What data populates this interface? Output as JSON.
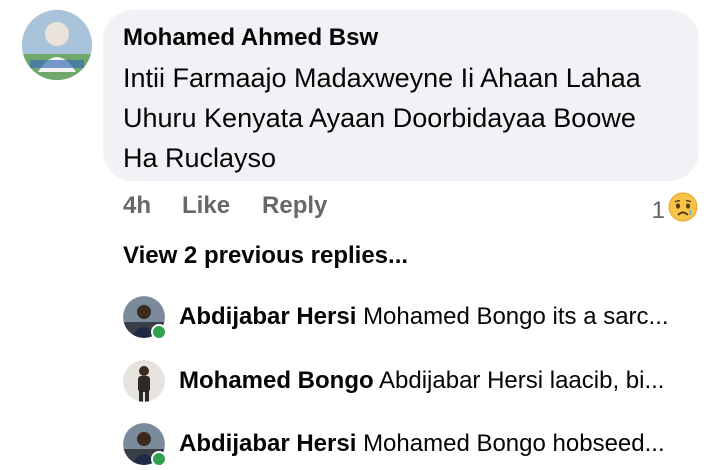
{
  "comment": {
    "author": "Mohamed Ahmed Bsw",
    "text": "Intii Farmaajo Madaxweyne Ii Ahaan Lahaa Uhuru Kenyata  Ayaan Doorbidayaa Boowe Ha Ruclayso",
    "time": "4h",
    "like_label": "Like",
    "reply_label": "Reply",
    "reaction_count": "1",
    "reaction_icon": "sad-face-icon"
  },
  "view_previous": "View 2 previous replies...",
  "replies": [
    {
      "name": "Abdijabar Hersi",
      "snippet": "Mohamed Bongo its a sarc...",
      "online": true
    },
    {
      "name": "Mohamed Bongo",
      "snippet": "Abdijabar Hersi laacib, bi...",
      "online": false
    },
    {
      "name": "Abdijabar Hersi",
      "snippet": "Mohamed Bongo hobseed...",
      "online": true
    }
  ],
  "colors": {
    "bubble": "#f0f2f5",
    "secondary_text": "#65676b",
    "online": "#31a24c"
  }
}
